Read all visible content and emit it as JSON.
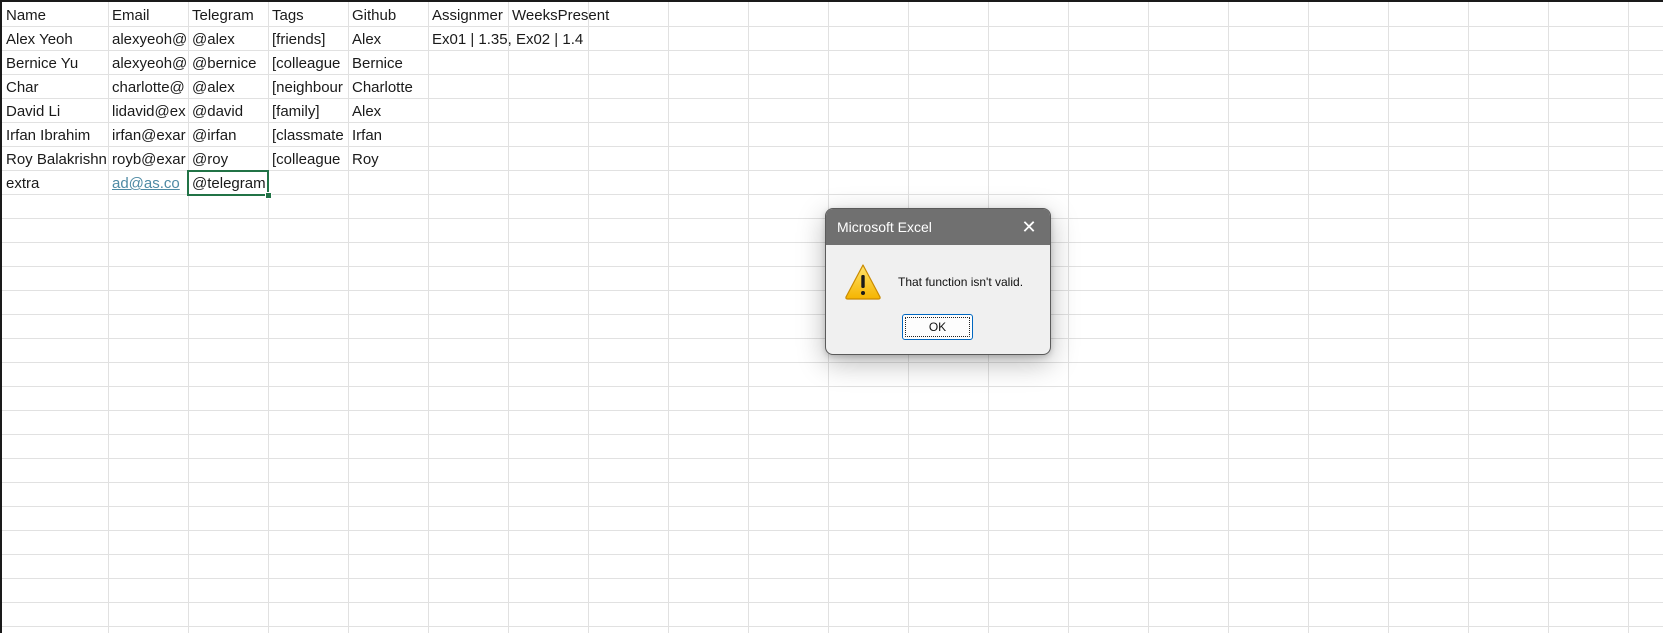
{
  "sheet": {
    "columns": [
      "Name",
      "Email",
      "Telegram",
      "Tags",
      "Github",
      "Assignmer",
      "WeeksPresent"
    ],
    "rows": [
      [
        "Alex Yeoh",
        "alexyeoh@",
        "@alex",
        "[friends]",
        "Alex",
        "Ex01 | 1.35, Ex02 | 1.4",
        ""
      ],
      [
        "Bernice Yu",
        "alexyeoh@",
        "@bernice",
        "[colleague",
        "Bernice",
        "",
        ""
      ],
      [
        "Char",
        "charlotte@",
        "@alex",
        "[neighbour",
        "Charlotte",
        "",
        ""
      ],
      [
        "David Li",
        "lidavid@ex",
        "@david",
        "[family]",
        "Alex",
        "",
        ""
      ],
      [
        "Irfan Ibrahim",
        "irfan@exar",
        "@irfan",
        "[classmate",
        "Irfan",
        "",
        ""
      ],
      [
        "Roy Balakrishn",
        "royb@exar",
        "@roy",
        "[colleague",
        "Roy",
        "",
        ""
      ],
      [
        "extra",
        "ad@as.co",
        "@telegram",
        "",
        "",
        "",
        ""
      ]
    ],
    "selected_cell": "C8",
    "link_color": "#4e8aa4",
    "selection_color": "#217346"
  },
  "dialog": {
    "title": "Microsoft Excel",
    "message": "That function isn't valid.",
    "ok_label": "OK",
    "close_icon": "close-icon",
    "warning_icon": "warning-icon",
    "titlebar_color": "#707070"
  }
}
